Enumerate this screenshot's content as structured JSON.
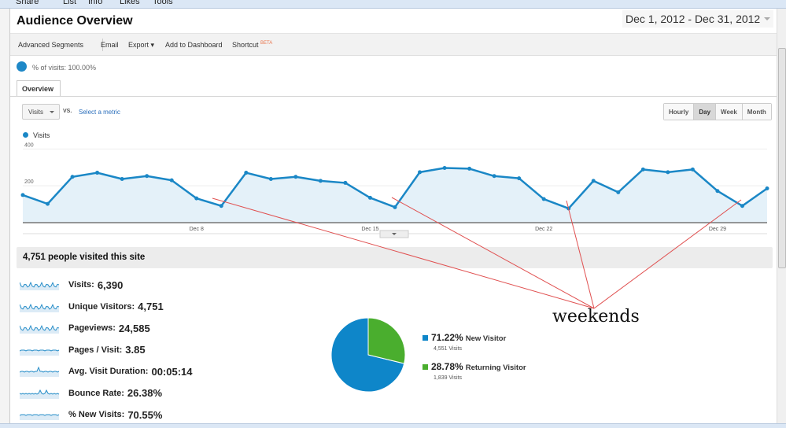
{
  "browser_toolbar": {
    "items": [
      "Share",
      "List",
      "Info",
      "Likes",
      "Tools"
    ]
  },
  "header": {
    "title": "Audience Overview",
    "date_range": "Dec 1, 2012 - Dec 31, 2012"
  },
  "actions": {
    "advanced_segments": "Advanced Segments",
    "email": "Email",
    "export": "Export ▾",
    "add_to_dashboard": "Add to Dashboard",
    "shortcut": "Shortcut",
    "beta": "BETA"
  },
  "segment": {
    "label": "% of visits: 100.00%"
  },
  "tabs": [
    {
      "label": "Overview",
      "active": true
    }
  ],
  "controls": {
    "metric": "Visits",
    "vs": "VS.",
    "select_metric": "Select a metric",
    "granularity": [
      "Hourly",
      "Day",
      "Week",
      "Month"
    ],
    "active_granularity": "Day"
  },
  "chart_data": {
    "type": "area",
    "legend": "Visits",
    "series_color": "#1a87c6",
    "x": [
      "Dec 1",
      "Dec 2",
      "Dec 3",
      "Dec 4",
      "Dec 5",
      "Dec 6",
      "Dec 7",
      "Dec 8",
      "Dec 9",
      "Dec 10",
      "Dec 11",
      "Dec 12",
      "Dec 13",
      "Dec 14",
      "Dec 15",
      "Dec 16",
      "Dec 17",
      "Dec 18",
      "Dec 19",
      "Dec 20",
      "Dec 21",
      "Dec 22",
      "Dec 23",
      "Dec 24",
      "Dec 25",
      "Dec 26",
      "Dec 27",
      "Dec 28",
      "Dec 29",
      "Dec 30",
      "Dec 31"
    ],
    "values": [
      150,
      102,
      249,
      271,
      237,
      253,
      230,
      132,
      91,
      271,
      237,
      249,
      227,
      216,
      135,
      84,
      274,
      297,
      293,
      253,
      241,
      128,
      77,
      227,
      165,
      289,
      274,
      289,
      172,
      91,
      186
    ],
    "x_ticks": [
      "Dec 8",
      "Dec 15",
      "Dec 22",
      "Dec 29"
    ],
    "y_ticks": [
      200,
      400
    ],
    "ylim": [
      0,
      440
    ],
    "grid": true
  },
  "summary": {
    "headline": "4,751 people visited this site",
    "metrics": [
      {
        "label": "Visits:",
        "value": "6,390"
      },
      {
        "label": "Unique Visitors:",
        "value": "4,751"
      },
      {
        "label": "Pageviews:",
        "value": "24,585"
      },
      {
        "label": "Pages / Visit:",
        "value": "3.85"
      },
      {
        "label": "Avg. Visit Duration:",
        "value": "00:05:14"
      },
      {
        "label": "Bounce Rate:",
        "value": "26.38%"
      },
      {
        "label": "% New Visits:",
        "value": "70.55%"
      }
    ]
  },
  "pie": {
    "slices": [
      {
        "pct": "71.22%",
        "name": "New Visitor",
        "visits": "4,551 Visits",
        "value": 71.22,
        "color": "#0e86c9"
      },
      {
        "pct": "28.78%",
        "name": "Returning Visitor",
        "visits": "1,839 Visits",
        "value": 28.78,
        "color": "#4aae2e"
      }
    ]
  },
  "annotation": {
    "text": "weekends",
    "color": "#e05050"
  }
}
